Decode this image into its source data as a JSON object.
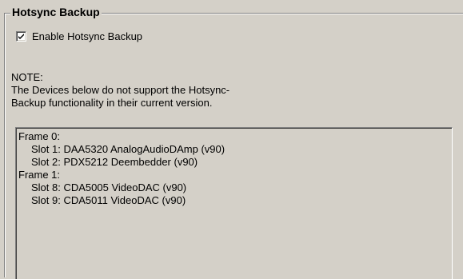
{
  "group": {
    "title": "Hotsync Backup"
  },
  "checkbox": {
    "label": "Enable Hotsync Backup",
    "checked": true
  },
  "note": {
    "heading": "NOTE:",
    "line1": "The Devices below do not support the Hotsync-",
    "line2": "Backup functionality in their current version."
  },
  "devices": {
    "frame0": "Frame 0:",
    "frame0_slot1": "Slot 1: DAA5320 AnalogAudioDAmp (v90)",
    "frame0_slot2": "Slot 2: PDX5212 Deembedder (v90)",
    "frame1": "Frame 1:",
    "frame1_slot8": "Slot 8: CDA5005 VideoDAC (v90)",
    "frame1_slot9": "Slot 9: CDA5011 VideoDAC (v90)"
  }
}
